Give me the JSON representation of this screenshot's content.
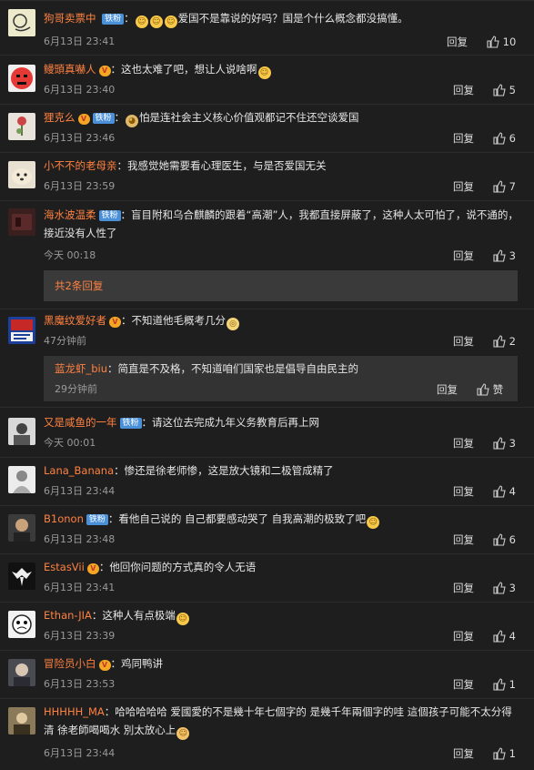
{
  "labels": {
    "reply": "回复",
    "more_replies": "共2条回复"
  },
  "comments": [
    {
      "user": "狗哥卖票中",
      "badge": "铁粉",
      "vip": false,
      "emojis": 3,
      "text": "爱国不是靠说的好吗？国是个什么概念都没搞懂。",
      "time": "6月13日 23:41",
      "likes": "10"
    },
    {
      "user": "鳗頭真嚇人",
      "badge": "",
      "vip": true,
      "text": "这也太难了吧，想让人说啥啊",
      "trail_emoji": true,
      "time": "6月13日 23:40",
      "likes": "5"
    },
    {
      "user": "狸克么",
      "badge": "铁粉",
      "vip": true,
      "lead_emoji": true,
      "text": "怕是连社会主义核心价值观都记不住还空谈爱国",
      "time": "6月13日 23:46",
      "likes": "6"
    },
    {
      "user": "小不不的老母亲",
      "badge": "",
      "vip": false,
      "text": "我感觉她需要看心理医生，与是否爱国无关",
      "time": "6月13日 23:59",
      "likes": "7"
    },
    {
      "user": "海水波温柔",
      "badge": "铁粉",
      "vip": false,
      "text": "盲目附和乌合麒麟的跟着“高潮”人，我都直接屏蔽了，这种人太可怕了，说不通的，接近没有人性了",
      "time": "今天 00:18",
      "likes": "3"
    },
    {
      "user": "黑魔纹爱好者",
      "badge": "",
      "vip": true,
      "text": "不知道他毛概考几分",
      "trail_emoji": true,
      "time": "47分钟前",
      "likes": "2",
      "sub": {
        "user": "蓝龙虾_biu",
        "text": "简直是不及格，不知道咱们国家也是倡导自由民主的",
        "time": "29分钟前",
        "like_label": "赞"
      }
    },
    {
      "user": "又是咸鱼的一年",
      "badge": "铁粉",
      "vip": false,
      "text": "请这位去完成九年义务教育后再上网",
      "time": "今天 00:01",
      "likes": "3"
    },
    {
      "user": "Lana_Banana",
      "badge": "",
      "vip": false,
      "text": "惨还是徐老师惨，这是放大镜和二极管成精了",
      "time": "6月13日 23:44",
      "likes": "4"
    },
    {
      "user": "B1onon",
      "badge": "铁粉",
      "vip": false,
      "text": "看他自己说的 自己都要感动哭了 自我高潮的极致了吧",
      "trail_emoji": true,
      "time": "6月13日 23:48",
      "likes": "6"
    },
    {
      "user": "EstasVii",
      "badge": "",
      "vip": true,
      "text": "他回你问题的方式真的令人无语",
      "time": "6月13日 23:41",
      "likes": "3"
    },
    {
      "user": "Ethan-JIA",
      "badge": "",
      "vip": false,
      "text": "这种人有点极端",
      "trail_emoji": true,
      "time": "6月13日 23:39",
      "likes": "4"
    },
    {
      "user": "冒险员小白",
      "badge": "",
      "vip": true,
      "text": "鸡同鸭讲",
      "time": "6月13日 23:53",
      "likes": "1"
    },
    {
      "user": "HHHHH_MA",
      "badge": "",
      "vip": false,
      "text": "哈哈哈哈哈 爱國愛的不是幾十年七個字的 是幾千年兩個字的哇 這個孩子可能不太分得清 徐老師喝喝水 別太放心上",
      "trail_emoji": true,
      "time": "6月13日 23:44",
      "likes": "1"
    }
  ]
}
